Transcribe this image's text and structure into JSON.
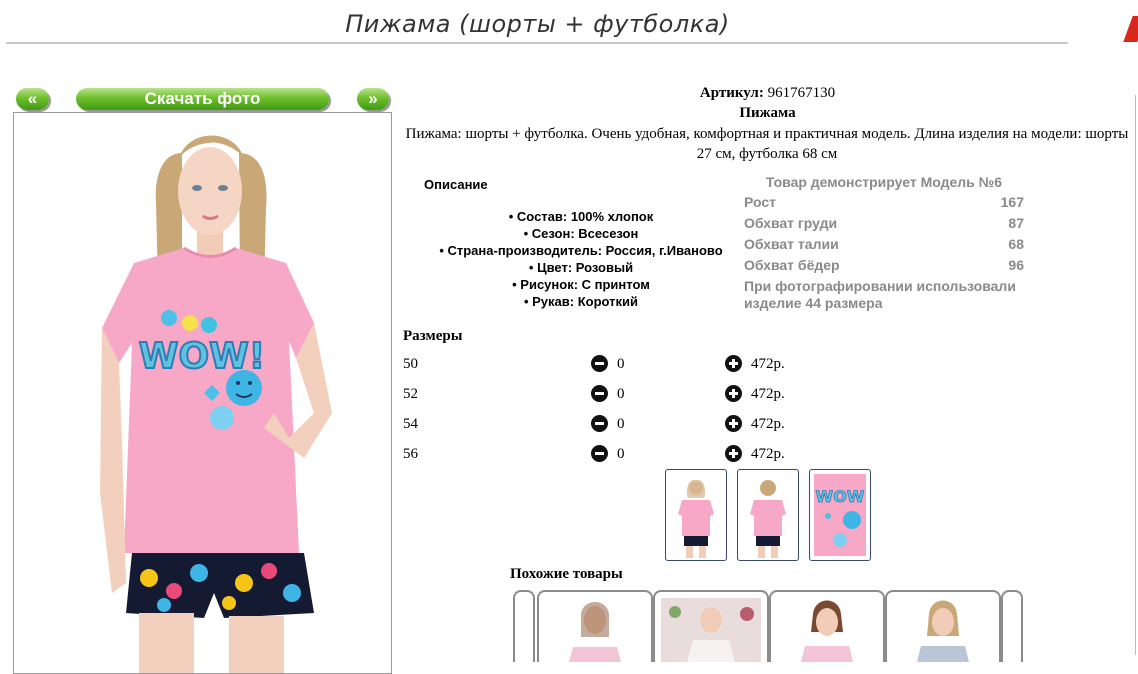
{
  "page": {
    "title": "Пижама (шорты + футболка)"
  },
  "gallery": {
    "prev_label": "«",
    "download_label": "Скачать фото",
    "next_label": "»"
  },
  "product": {
    "article_label": "Артикул:",
    "article_value": "961767130",
    "name": "Пижама",
    "description": "Пижама: шорты + футболка. Очень удобная, комфортная и практичная модель. Длина изделия на модели: шорты 27 см, футболка 68 см"
  },
  "specs": {
    "heading": "Описание",
    "items": [
      "Состав: 100% хлопок",
      "Сезон: Всесезон",
      "Страна-производитель: Россия, г.Иваново",
      "Цвет: Розовый",
      "Рисунок: С принтом",
      "Рукав: Короткий"
    ]
  },
  "model_info": {
    "heading": "Товар демонстрирует Модель №6",
    "rows": [
      {
        "label": "Рост",
        "value": "167"
      },
      {
        "label": "Обхват груди",
        "value": "87"
      },
      {
        "label": "Обхват талии",
        "value": "68"
      },
      {
        "label": "Обхват бёдер",
        "value": "96"
      }
    ],
    "note": "При фотографировании использовали изделие 44 размера"
  },
  "sizes": {
    "heading": "Размеры",
    "rows": [
      {
        "size": "50",
        "qty": "0",
        "price": "472р."
      },
      {
        "size": "52",
        "qty": "0",
        "price": "472р."
      },
      {
        "size": "54",
        "qty": "0",
        "price": "472р."
      },
      {
        "size": "56",
        "qty": "0",
        "price": "472р."
      }
    ]
  },
  "similar": {
    "heading": "Похожие товары"
  },
  "photo": {
    "print_text": "WOW!"
  },
  "colors": {
    "shirt": "#f6a8c6",
    "button_green": "#4fa61a"
  }
}
